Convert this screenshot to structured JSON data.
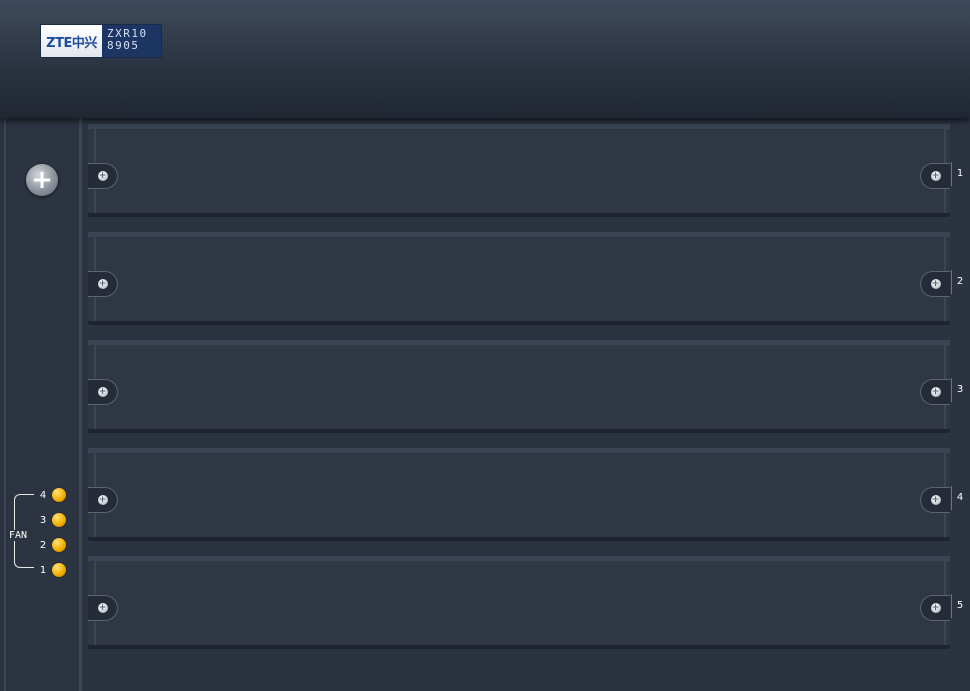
{
  "header": {
    "logo_brand": "ZTE中兴",
    "model_line1": "ZXR10",
    "model_line2": "8905"
  },
  "left_panel": {
    "add_symbol": "+",
    "fan_label": "FAN",
    "fans": [
      {
        "number": "4",
        "status_color": "#f2b100"
      },
      {
        "number": "3",
        "status_color": "#f2b100"
      },
      {
        "number": "2",
        "status_color": "#f2b100"
      },
      {
        "number": "1",
        "status_color": "#f2b100"
      }
    ]
  },
  "slots": [
    {
      "number": "1"
    },
    {
      "number": "2"
    },
    {
      "number": "3"
    },
    {
      "number": "4"
    },
    {
      "number": "5"
    }
  ],
  "icons": {
    "add": "plus-circle-icon",
    "screw": "screw-icon",
    "fan_led": "status-led-icon"
  },
  "colors": {
    "background": "#2b3340",
    "header": "#2a3240",
    "fan_led": "#f2b100",
    "logo_blue": "#1c3563"
  }
}
